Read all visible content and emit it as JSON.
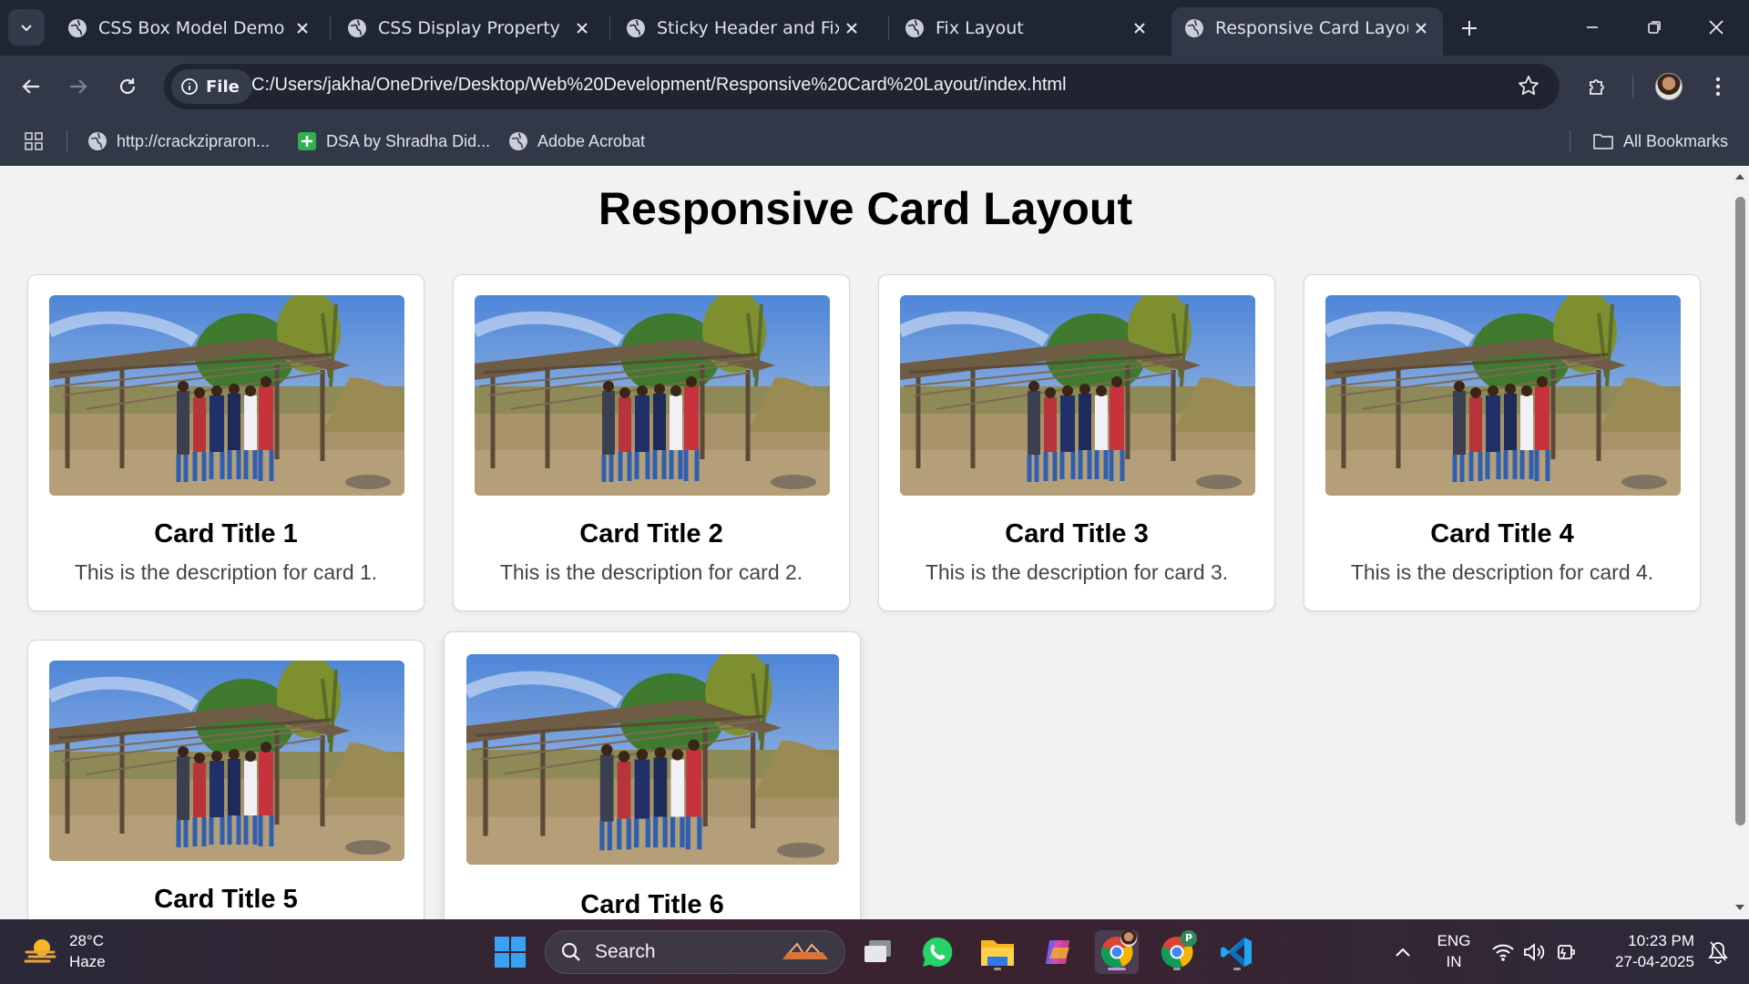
{
  "browser": {
    "tabs": [
      {
        "label": "CSS Box Model Demo",
        "active": false
      },
      {
        "label": "CSS Display Property",
        "active": false
      },
      {
        "label": "Sticky Header and Fixed F",
        "active": false
      },
      {
        "label": "Fix Layout",
        "active": false
      },
      {
        "label": "Responsive Card Layout",
        "active": true
      }
    ],
    "address": {
      "scheme_chip": "File",
      "url": "C:/Users/jakha/OneDrive/Desktop/Web%20Development/Responsive%20Card%20Layout/index.html"
    },
    "bookmarks": [
      {
        "label": "http://crackzipraron...",
        "icon": "globe-icon"
      },
      {
        "label": "DSA by Shradha Did...",
        "icon": "green-plus-icon"
      },
      {
        "label": "Adobe Acrobat",
        "icon": "globe-icon"
      }
    ],
    "all_bookmarks_label": "All Bookmarks"
  },
  "page": {
    "title": "Responsive Card Layout",
    "cards": [
      {
        "title": "Card Title 1",
        "description": "This is the description for card 1."
      },
      {
        "title": "Card Title 2",
        "description": "This is the description for card 2."
      },
      {
        "title": "Card Title 3",
        "description": "This is the description for card 3."
      },
      {
        "title": "Card Title 4",
        "description": "This is the description for card 4."
      },
      {
        "title": "Card Title 5",
        "description": ""
      },
      {
        "title": "Card Title 6",
        "description": ""
      }
    ]
  },
  "taskbar": {
    "weather": {
      "temp": "28°C",
      "condition": "Haze"
    },
    "search_label": "Search",
    "apps": [
      "windows-start-icon",
      "search-icon",
      "task-view-icon",
      "whatsapp-icon",
      "file-explorer-icon",
      "copilot-icon",
      "chrome-icon",
      "chrome-profile-icon",
      "vscode-icon"
    ],
    "language": {
      "line1": "ENG",
      "line2": "IN"
    },
    "clock": {
      "time": "10:23 PM",
      "date": "27-04-2025"
    }
  },
  "colors": {
    "browser_frame": "#202534",
    "toolbar": "#323847",
    "page_bg": "#f2f2f2",
    "card_bg": "#ffffff"
  }
}
